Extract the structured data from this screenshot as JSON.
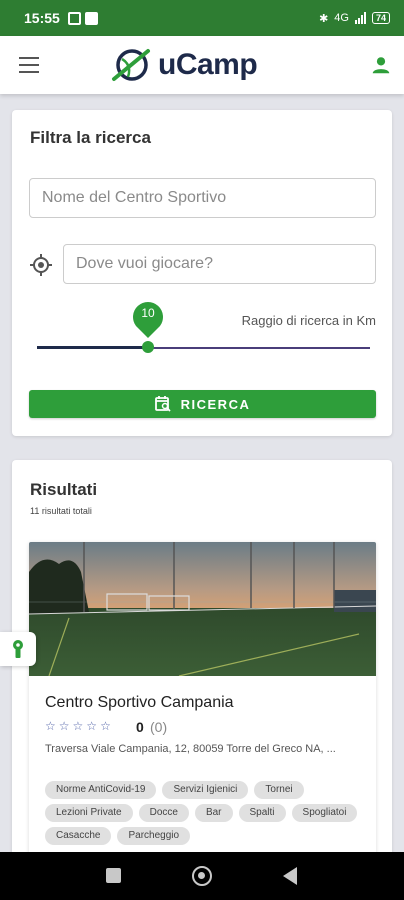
{
  "status_bar": {
    "time": "15:55",
    "network": "4G",
    "battery": "74"
  },
  "app": {
    "name": "uCamp"
  },
  "filter": {
    "title": "Filtra la ricerca",
    "name_placeholder": "Nome del Centro Sportivo",
    "location_placeholder": "Dove vuoi giocare?",
    "radius_value": "10",
    "radius_label": "Raggio di ricerca in Km",
    "search_button": "RICERCA"
  },
  "results": {
    "title": "Risultati",
    "count_text": "11 risultati totali",
    "items": [
      {
        "name": "Centro Sportivo Campania",
        "stars": [
          "☆",
          "☆",
          "☆",
          "☆",
          "☆"
        ],
        "rating": "0",
        "rating_count": "(0)",
        "address": "Traversa Viale Campania, 12, 80059 Torre del Greco NA, ...",
        "tags": [
          "Norme AntiCovid-19",
          "Servizi Igienici",
          "Tornei",
          "Lezioni Private",
          "Docce",
          "Bar",
          "Spalti",
          "Spogliatoi",
          "Casacche",
          "Parcheggio"
        ]
      }
    ]
  },
  "colors": {
    "primary_green": "#2e9e3a",
    "status_green": "#2e7d32",
    "logo_navy": "#1e2a4a"
  },
  "icons": [
    "menu-icon",
    "user-icon",
    "target-icon",
    "calendar-search-icon",
    "star-icon",
    "keyhole-icon"
  ]
}
